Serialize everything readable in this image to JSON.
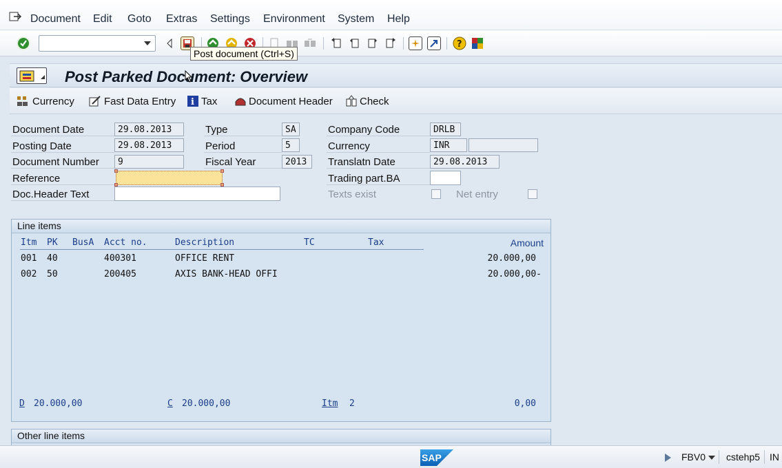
{
  "menubar": {
    "items": [
      {
        "label": "Document"
      },
      {
        "label": "Edit"
      },
      {
        "label": "Goto"
      },
      {
        "label": "Extras"
      },
      {
        "label": "Settings"
      },
      {
        "label": "Environment"
      },
      {
        "label": "System"
      },
      {
        "label": "Help"
      }
    ]
  },
  "toolbar": {
    "command_field_value": "",
    "tooltip": "Post document   (Ctrl+S)",
    "icons": [
      "enter-icon",
      "back-icon",
      "save-icon",
      "green-back-icon",
      "exit-icon",
      "cancel-icon",
      "print-icon",
      "find-icon",
      "find-next-icon",
      "first-page-icon",
      "previous-page-icon",
      "next-page-icon",
      "last-page-icon",
      "create-session-icon",
      "shortcut-icon",
      "help-icon",
      "customize-layout-icon"
    ]
  },
  "title": "Post Parked Document: Overview",
  "appbar": {
    "currency": "Currency",
    "fast_data_entry": "Fast Data Entry",
    "tax": "Tax",
    "document_header": "Document Header",
    "check": "Check"
  },
  "header": {
    "document_date_label": "Document Date",
    "document_date": "29.08.2013",
    "posting_date_label": "Posting Date",
    "posting_date": "29.08.2013",
    "document_number_label": "Document Number",
    "document_number": "9",
    "reference_label": "Reference",
    "reference": "",
    "doc_header_text_label": "Doc.Header Text",
    "doc_header_text": "",
    "type_label": "Type",
    "type": "SA",
    "period_label": "Period",
    "period": "5",
    "fiscal_year_label": "Fiscal Year",
    "fiscal_year": "2013",
    "company_code_label": "Company Code",
    "company_code": "DRLB",
    "currency_label": "Currency",
    "currency": "INR",
    "translatn_date_label": "Translatn Date",
    "translatn_date": "29.08.2013",
    "trading_part_label": "Trading part.BA",
    "trading_part": "",
    "texts_exist_label": "Texts exist",
    "net_entry_label": "Net entry"
  },
  "line_items": {
    "title": "Line items",
    "columns": {
      "itm": "Itm",
      "pk": "PK",
      "busa": "BusA",
      "acct": "Acct no.",
      "description": "Description",
      "tc": "TC",
      "tax": "Tax",
      "amount": "Amount"
    },
    "rows": [
      {
        "itm": "001",
        "pk": "40",
        "acct": "400301",
        "description": "OFFICE RENT",
        "amount": "20.000,00"
      },
      {
        "itm": "002",
        "pk": "50",
        "acct": "200405",
        "description": "AXIS BANK-HEAD OFFI",
        "amount": "20.000,00-"
      }
    ],
    "totals": {
      "debit_label": "D",
      "debit": "20.000,00",
      "credit_label": "C",
      "credit": "20.000,00",
      "items_label": "Itm",
      "items": "2",
      "balance": "0,00"
    }
  },
  "other_line_items": {
    "title": "Other line items"
  },
  "status": {
    "logo": "SAP",
    "transaction": "FBV0",
    "server": "cstehp5",
    "mode": "IN"
  },
  "colors": {
    "title_bar": "#dbe5ef",
    "line_items_bg": "#d6e3f0",
    "header_blue": "#1a3e8a",
    "reference_highlight": "#fbe49a"
  }
}
